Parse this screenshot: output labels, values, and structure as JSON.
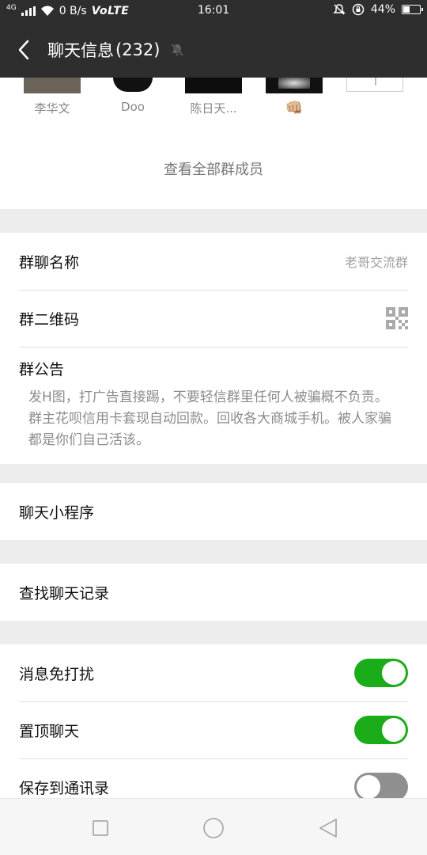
{
  "status_bar": {
    "network": "4G",
    "speed": "0 B/s",
    "volte": "VoLTE",
    "time": "16:01",
    "battery": "44%"
  },
  "header": {
    "title": "聊天信息",
    "count": "(232)",
    "back_icon": "chevron-left-icon",
    "mute_icon": "bell-off-icon"
  },
  "members": [
    {
      "name": "李华文"
    },
    {
      "name": "Doo"
    },
    {
      "name": "陈日天..."
    },
    {
      "name": "👊🏼"
    }
  ],
  "view_all_members": "查看全部群成员",
  "group": {
    "name_label": "群聊名称",
    "name_value": "老哥交流群",
    "qr_label": "群二维码",
    "notice_label": "群公告",
    "notice_text": "发H图，打广告直接踢，不要轻信群里任何人被骗概不负责。群主花呗信用卡套现自动回款。回收各大商城手机。被人家骗都是你们自己活该。"
  },
  "mini_program_label": "聊天小程序",
  "search_history_label": "查找聊天记录",
  "settings": {
    "mute_label": "消息免打扰",
    "mute_on": true,
    "pin_label": "置顶聊天",
    "pin_on": true,
    "save_label": "保存到通讯录",
    "save_on": false
  },
  "colors": {
    "header_bg": "#2e2e2e",
    "toggle_on": "#1aad19",
    "toggle_off": "#8f8f8f"
  }
}
